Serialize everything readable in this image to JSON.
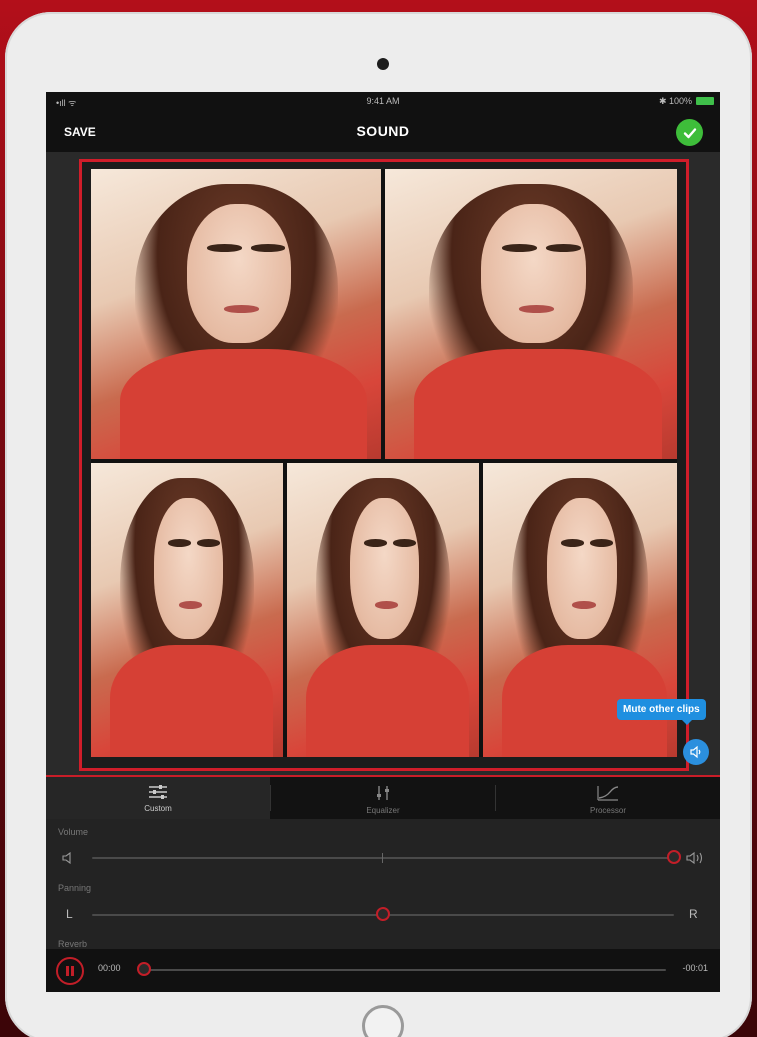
{
  "statusbar": {
    "carrier": "•ıll ᯤ",
    "time": "9:41 AM",
    "battery": "✱ 100%"
  },
  "navbar": {
    "save_label": "SAVE",
    "title": "SOUND"
  },
  "clips": [
    {
      "name": "clip-1"
    },
    {
      "name": "clip-2"
    },
    {
      "name": "clip-3"
    },
    {
      "name": "clip-4"
    },
    {
      "name": "clip-5"
    }
  ],
  "tooltip": {
    "mute_label": "Mute other clips"
  },
  "tabs": [
    {
      "label": "Custom",
      "icon": "sliders-icon",
      "active": true
    },
    {
      "label": "Equalizer",
      "icon": "equalizer-icon",
      "active": false
    },
    {
      "label": "Processor",
      "icon": "curve-icon",
      "active": false
    }
  ],
  "controls": {
    "volume": {
      "label": "Volume",
      "value": 1.0
    },
    "panning": {
      "label": "Panning",
      "left": "L",
      "right": "R",
      "value": 0.5
    },
    "next_label": "Reverb"
  },
  "playback": {
    "current": "00:00",
    "remaining": "-00:01",
    "progress": 0.0
  },
  "colors": {
    "accent": "#c91d28",
    "confirm": "#3ebd3a",
    "tooltip": "#1f8fe0"
  }
}
